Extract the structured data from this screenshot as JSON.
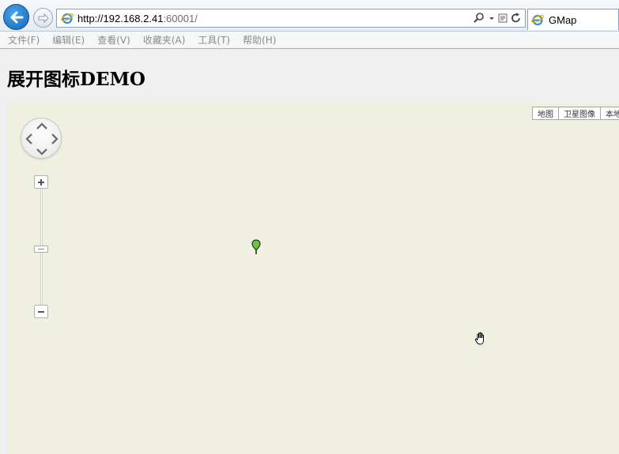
{
  "browser": {
    "url_host": "http://192.168.2.41",
    "url_rest": ":60001/",
    "tab_title": "GMap"
  },
  "menu": [
    {
      "label": "文件(F)"
    },
    {
      "label": "编辑(E)"
    },
    {
      "label": "查看(V)"
    },
    {
      "label": "收藏夹(A)"
    },
    {
      "label": "工具(T)"
    },
    {
      "label": "帮助(H)"
    }
  ],
  "page": {
    "title": "展开图标DEMO"
  },
  "map": {
    "types": [
      {
        "label": "地图"
      },
      {
        "label": "卫星图像"
      },
      {
        "label": "本地数"
      }
    ],
    "background": "#f0f0e1",
    "marker_color": "#6cc24a"
  },
  "icons": {
    "back": "back-arrow-icon",
    "forward": "forward-arrow-icon",
    "ie": "internet-explorer-icon",
    "search": "search-icon",
    "refresh": "refresh-icon",
    "compat": "compatibility-view-icon",
    "marker": "map-marker-icon",
    "cursor": "hand-cursor-icon"
  }
}
